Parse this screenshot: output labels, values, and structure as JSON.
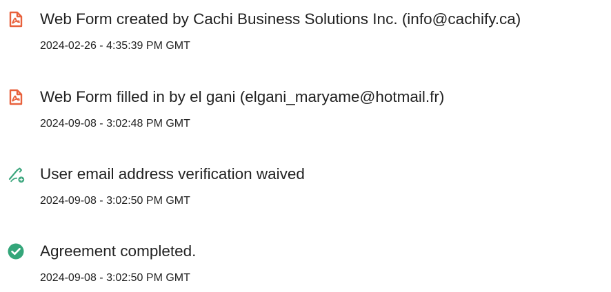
{
  "colors": {
    "pdf_icon": "#e8613c",
    "verification_icon": "#3aa57c",
    "completed_icon": "#34a67a",
    "text": "#222222"
  },
  "events": [
    {
      "icon": "pdf-document-icon",
      "title": "Web Form created by Cachi Business Solutions Inc. (info@cachify.ca)",
      "timestamp": "2024-02-26 - 4:35:39 PM GMT"
    },
    {
      "icon": "pdf-document-icon",
      "title": "Web Form filled in by el gani (elgani_maryame@hotmail.fr)",
      "timestamp": "2024-09-08 - 3:02:48 PM GMT"
    },
    {
      "icon": "pen-email-verification-icon",
      "title": "User email address verification waived",
      "timestamp": "2024-09-08 - 3:02:50 PM GMT"
    },
    {
      "icon": "check-circle-icon",
      "title": "Agreement completed.",
      "timestamp": "2024-09-08 - 3:02:50 PM GMT"
    }
  ]
}
